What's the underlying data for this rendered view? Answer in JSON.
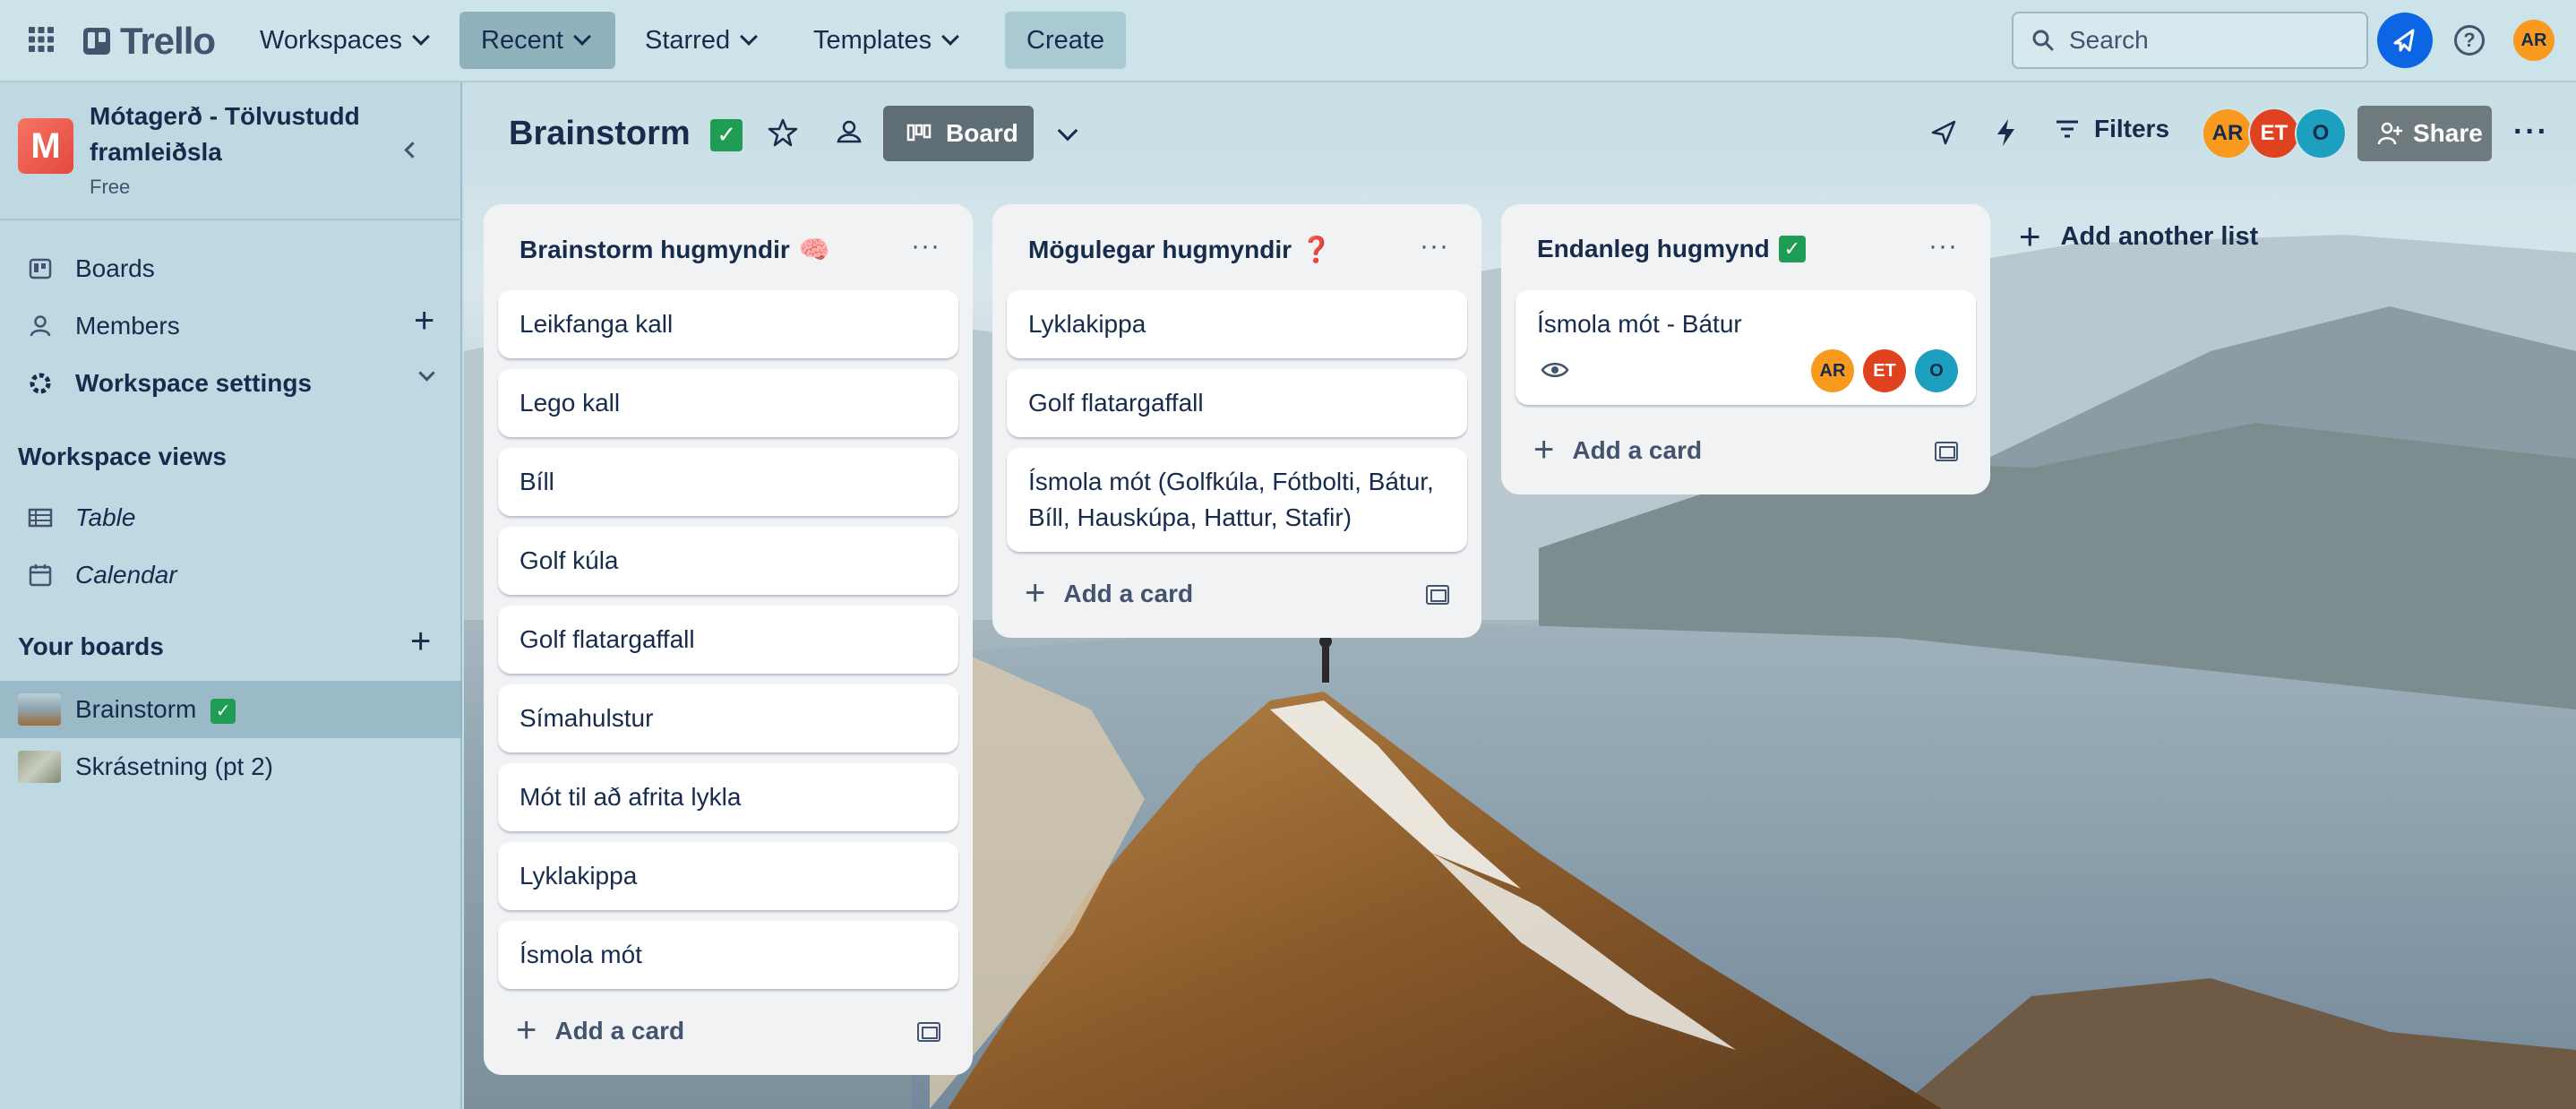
{
  "topnav": {
    "logo": "Trello",
    "menus": [
      {
        "label": "Workspaces"
      },
      {
        "label": "Recent"
      },
      {
        "label": "Starred"
      },
      {
        "label": "Templates"
      }
    ],
    "create_label": "Create",
    "search_placeholder": "Search",
    "user_initials": "AR"
  },
  "sidebar": {
    "workspace_initial": "M",
    "workspace_name_line1": "Mótagerð - Tölvustudd",
    "workspace_name_line2": "framleiðsla",
    "workspace_plan": "Free",
    "items": [
      {
        "label": "Boards"
      },
      {
        "label": "Members"
      },
      {
        "label": "Workspace settings"
      }
    ],
    "views_heading": "Workspace views",
    "views": [
      {
        "label": "Table"
      },
      {
        "label": "Calendar"
      }
    ],
    "your_boards_heading": "Your boards",
    "boards": [
      {
        "label": "Brainstorm",
        "checked": true
      },
      {
        "label": "Skrásetning (pt 2)"
      }
    ]
  },
  "board": {
    "title": "Brainstorm",
    "view_label": "Board",
    "filters_label": "Filters",
    "share_label": "Share",
    "members": [
      {
        "initials": "AR",
        "color": "#f79a1e"
      },
      {
        "initials": "ET",
        "color": "#e0411f"
      },
      {
        "initials": "O",
        "color": "#1d9fbf"
      }
    ],
    "add_list_label": "Add another list",
    "add_card_label": "Add a card",
    "lists": [
      {
        "title": "Brainstorm hugmyndir",
        "emoji": "🧠",
        "cards": [
          "Leikfanga kall",
          "Lego kall",
          "Bíll",
          "Golf kúla",
          "Golf flatargaffall",
          "Símahulstur",
          "Mót til að afrita lykla",
          "Lyklakippa",
          "Ísmola mót"
        ]
      },
      {
        "title": "Mögulegar hugmyndir",
        "emoji": "❓",
        "cards": [
          "Lyklakippa",
          "Golf flatargaffall",
          "Ísmola mót (Golfkúla, Fótbolti, Bátur, Bíll, Hauskúpa, Hattur, Stafir)"
        ]
      },
      {
        "title": "Endanleg hugmynd",
        "emoji": "✅",
        "cards": [
          "Ísmola mót - Bátur"
        ],
        "card_members": [
          "AR",
          "ET",
          "O"
        ]
      }
    ]
  },
  "colors": {
    "accent": "#0c66e4",
    "avatar_ar": "#f79a1e",
    "avatar_et": "#e0411f",
    "avatar_o": "#1d9fbf",
    "check": "#1f9d55"
  }
}
